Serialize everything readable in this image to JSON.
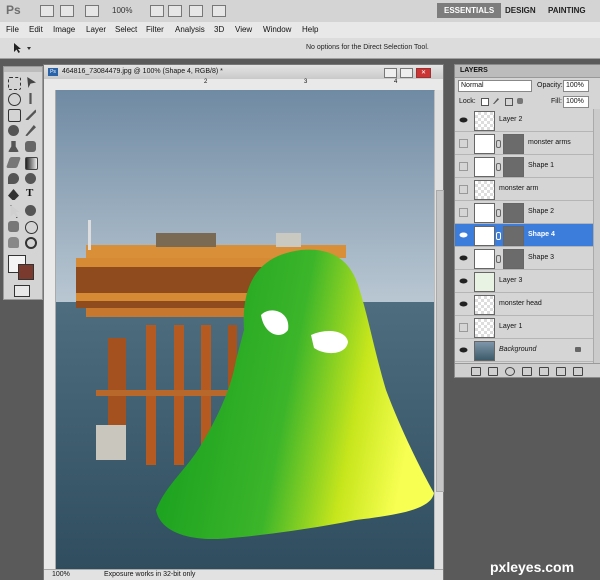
{
  "app": {
    "logo": "Ps",
    "zoom": "100%"
  },
  "workspaces": [
    "ESSENTIALS",
    "DESIGN",
    "PAINTING"
  ],
  "menu": [
    "File",
    "Edit",
    "Image",
    "Layer",
    "Select",
    "Filter",
    "Analysis",
    "3D",
    "View",
    "Window",
    "Help"
  ],
  "options_bar": {
    "message": "No options for the Direct Selection Tool."
  },
  "document": {
    "title": "464816_73084479.jpg @ 100% (Shape 4, RGB/8) *",
    "zoom": "100%",
    "status": "Exposure works in 32-bit only",
    "ruler_marks": [
      "2",
      "3",
      "4"
    ]
  },
  "layers_panel": {
    "tab": "LAYERS",
    "blend_mode": "Normal",
    "opacity_label": "Opacity:",
    "opacity": "100%",
    "lock_label": "Lock:",
    "fill_label": "Fill:",
    "fill": "100%",
    "layers": [
      {
        "name": "Layer 2",
        "visible": true,
        "selected": false,
        "mask": false
      },
      {
        "name": "monster arms",
        "visible": false,
        "selected": false,
        "mask": true
      },
      {
        "name": "Shape 1",
        "visible": false,
        "selected": false,
        "mask": true
      },
      {
        "name": "monster arm",
        "visible": false,
        "selected": false,
        "mask": false
      },
      {
        "name": "Shape 2",
        "visible": false,
        "selected": false,
        "mask": true
      },
      {
        "name": "Shape 4",
        "visible": true,
        "selected": true,
        "mask": true
      },
      {
        "name": "Shape 3",
        "visible": true,
        "selected": false,
        "mask": true
      },
      {
        "name": "Layer 3",
        "visible": true,
        "selected": false,
        "mask": false
      },
      {
        "name": "monster head",
        "visible": true,
        "selected": false,
        "mask": false
      },
      {
        "name": "Layer 1",
        "visible": false,
        "selected": false,
        "mask": false
      },
      {
        "name": "Background",
        "visible": true,
        "selected": false,
        "mask": false
      }
    ],
    "footer_icons": [
      "link-icon",
      "fx-icon",
      "mask-icon",
      "adjustment-icon",
      "group-icon",
      "new-layer-icon",
      "trash-icon"
    ]
  },
  "watermark": "pxleyes.com"
}
